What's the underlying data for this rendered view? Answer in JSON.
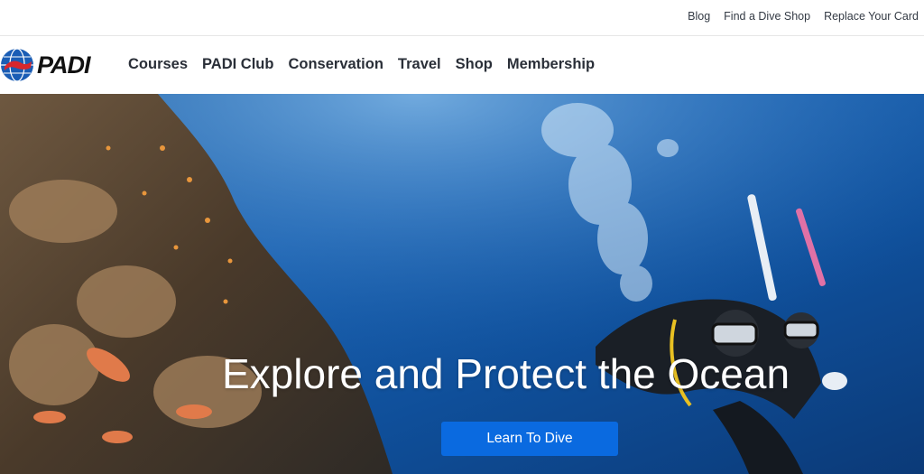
{
  "utility_nav": {
    "links": [
      "Blog",
      "Find a Dive Shop",
      "Replace Your Card"
    ]
  },
  "brand": {
    "name": "PADI",
    "primary_color": "#0a6ae0",
    "logo_globe_color": "#1a5db5",
    "logo_diver_color": "#d7262c"
  },
  "main_nav": {
    "items": [
      "Courses",
      "PADI Club",
      "Conservation",
      "Travel",
      "Shop",
      "Membership"
    ]
  },
  "hero": {
    "title": "Explore and Protect the Ocean",
    "cta_label": "Learn To Dive",
    "image_subject": "two scuba divers beside a coral reef with fish"
  }
}
